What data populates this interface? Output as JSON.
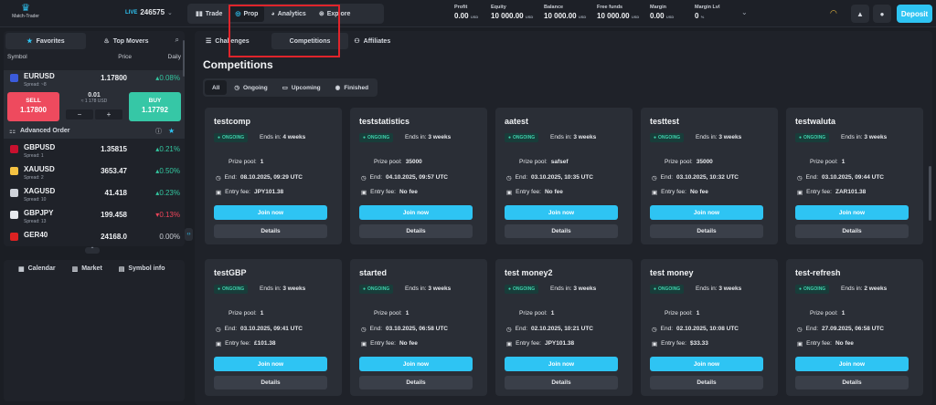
{
  "app": {
    "logo_text": "Match-Trader"
  },
  "account": {
    "mode": "LIVE",
    "id": "246575"
  },
  "nav": {
    "items": [
      {
        "label": "Trade",
        "icon": "chart-bars-icon"
      },
      {
        "label": "Prop",
        "icon": "target-icon"
      },
      {
        "label": "Analytics",
        "icon": "analytics-icon"
      },
      {
        "label": "Explore",
        "icon": "compass-icon"
      }
    ]
  },
  "stats": [
    {
      "label": "Profit",
      "value": "0.00",
      "unit": "USD"
    },
    {
      "label": "Equity",
      "value": "10 000.00",
      "unit": "USD"
    },
    {
      "label": "Balance",
      "value": "10 000.00",
      "unit": "USD"
    },
    {
      "label": "Free funds",
      "value": "10 000.00",
      "unit": "USD"
    },
    {
      "label": "Margin",
      "value": "0.00",
      "unit": "USD"
    },
    {
      "label": "Margin Lvl",
      "value": "0",
      "unit": "%"
    }
  ],
  "deposit_label": "Deposit",
  "left": {
    "tabs": [
      "Favorites",
      "Top Movers"
    ],
    "headers": {
      "symbol": "Symbol",
      "price": "Price",
      "daily": "Daily"
    },
    "selected": {
      "symbol": "EURUSD",
      "spread": "Spread: ~8",
      "price": "1.17800",
      "change": "0.08%"
    },
    "trade": {
      "sell_label": "SELL",
      "sell_price": "1.17800",
      "buy_label": "BUY",
      "buy_price": "1.17792",
      "volume": "0.01",
      "volume_sub": "≈ 1 178 USD",
      "minus": "−",
      "plus": "+"
    },
    "advanced_order": "Advanced Order",
    "symbols": [
      {
        "symbol": "GBPUSD",
        "spread": "Spread: 1",
        "price": "1.35815",
        "change": "0.21%",
        "dir": "up",
        "color": "#c8102e"
      },
      {
        "symbol": "XAUUSD",
        "spread": "Spread: 2",
        "price": "3653.47",
        "change": "0.50%",
        "dir": "up",
        "color": "#f5c242"
      },
      {
        "symbol": "XAGUSD",
        "spread": "Spread: 10",
        "price": "41.418",
        "change": "0.23%",
        "dir": "up",
        "color": "#cfd3da"
      },
      {
        "symbol": "GBPJPY",
        "spread": "Spread: 13",
        "price": "199.458",
        "change": "0.13%",
        "dir": "down",
        "color": "#c8102e"
      },
      {
        "symbol": "GER40",
        "spread": "",
        "price": "24168.0",
        "change": "0.00%",
        "dir": "flat",
        "color": "#dd2222"
      }
    ],
    "bottom_tabs": [
      "Calendar",
      "Market",
      "Symbol info"
    ]
  },
  "main": {
    "tabs": [
      "Challenges",
      "Competitions",
      "Affiliates"
    ],
    "title": "Competitions",
    "filters": [
      "All",
      "Ongoing",
      "Upcoming",
      "Finished"
    ],
    "labels": {
      "prize": "Prize pool:",
      "end": "End:",
      "fee": "Entry fee:",
      "ends_in": "Ends in:",
      "join": "Join now",
      "details": "Details",
      "badge": "ONGOING"
    },
    "cards": [
      {
        "title": "testcomp",
        "ends": "4 weeks",
        "prize": "1",
        "end": "08.10.2025, 09:29 UTC",
        "fee": "JPY101.38"
      },
      {
        "title": "teststatistics",
        "ends": "3 weeks",
        "prize": "35000",
        "end": "04.10.2025, 09:57 UTC",
        "fee": "No fee"
      },
      {
        "title": "aatest",
        "ends": "3 weeks",
        "prize": "safsef",
        "end": "03.10.2025, 10:35 UTC",
        "fee": "No fee"
      },
      {
        "title": "testtest",
        "ends": "3 weeks",
        "prize": "35000",
        "end": "03.10.2025, 10:32 UTC",
        "fee": "No fee"
      },
      {
        "title": "testwaluta",
        "ends": "3 weeks",
        "prize": "1",
        "end": "03.10.2025, 09:44 UTC",
        "fee": "ZAR101.38"
      },
      {
        "title": "testGBP",
        "ends": "3 weeks",
        "prize": "1",
        "end": "03.10.2025, 09:41 UTC",
        "fee": "£101.38"
      },
      {
        "title": "started",
        "ends": "3 weeks",
        "prize": "1",
        "end": "03.10.2025, 06:58 UTC",
        "fee": "No fee"
      },
      {
        "title": "test money2",
        "ends": "3 weeks",
        "prize": "1",
        "end": "02.10.2025, 10:21 UTC",
        "fee": "JPY101.38"
      },
      {
        "title": "test money",
        "ends": "3 weeks",
        "prize": "1",
        "end": "02.10.2025, 10:08 UTC",
        "fee": "$33.33"
      },
      {
        "title": "test-refresh",
        "ends": "2 weeks",
        "prize": "1",
        "end": "27.09.2025, 06:58 UTC",
        "fee": "No fee"
      }
    ]
  },
  "colors": {
    "accent": "#2ec4f3",
    "sell": "#ee4a5e",
    "buy": "#36c7a6",
    "highlight": "#e0242b"
  }
}
